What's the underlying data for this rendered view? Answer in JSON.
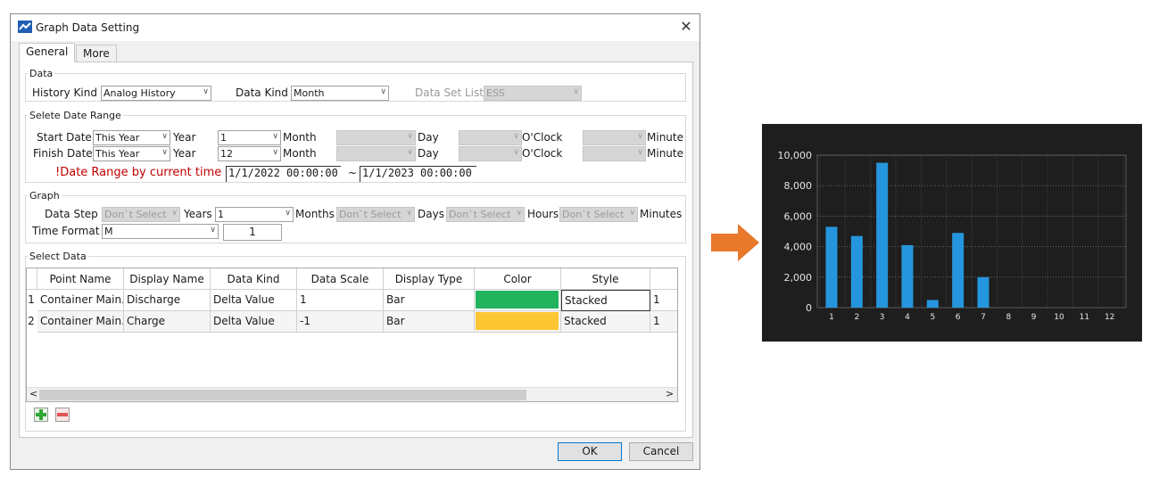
{
  "dialog": {
    "title": "Graph Data Setting",
    "close": "✕",
    "tabs": [
      "General",
      "More"
    ],
    "data_section": {
      "legend": "Data",
      "history_kind_label": "History Kind :",
      "history_kind_value": "Analog History",
      "data_kind_label": "Data Kind :",
      "data_kind_value": "Month",
      "data_set_list_label": "Data Set List :",
      "data_set_list_value": "ESS"
    },
    "date_range": {
      "legend": "Selete Date Range",
      "start_label": "Start Date :",
      "finish_label": "Finish Date :",
      "start": {
        "year_combo": "This Year",
        "month": "1"
      },
      "finish": {
        "year_combo": "This Year",
        "month": "12"
      },
      "year_label": "Year",
      "month_label": "Month",
      "day_label": "Day",
      "oclock_label": "O'Clock",
      "minute_label": "Minute",
      "note": "!Date Range by current time :",
      "from": "1/1/2022 00:00:00",
      "tilde": "~",
      "to": "1/1/2023 00:00:00"
    },
    "graph": {
      "legend": "Graph",
      "data_step_label": "Data Step :",
      "dont_select": "Don`t Select",
      "years_label": "Years",
      "years_value": "1",
      "months_label": "Months",
      "days_label": "Days",
      "hours_label": "Hours",
      "minutes_label": "Minutes",
      "time_format_label": "Time Format :",
      "time_format_value": "M",
      "time_format_num": "1"
    },
    "select_data": {
      "legend": "Select Data",
      "columns": [
        "Point Name",
        "Display Name",
        "Data Kind",
        "Data Scale",
        "Display Type",
        "Color",
        "Style"
      ],
      "rows": [
        {
          "no": "1",
          "point": "Container Main....",
          "display": "Discharge",
          "kind": "Delta Value",
          "scale": "1",
          "type": "Bar",
          "color": "#22b35c",
          "style": "Stacked",
          "extra": "1"
        },
        {
          "no": "2",
          "point": "Container Main....",
          "display": "Charge",
          "kind": "Delta Value",
          "scale": "-1",
          "type": "Bar",
          "color": "#fcc732",
          "style": "Stacked",
          "extra": "1"
        }
      ],
      "scroll_left": "<",
      "scroll_right": ">"
    },
    "buttons": {
      "ok": "OK",
      "cancel": "Cancel"
    }
  },
  "colors": {
    "arrow": "#e8782a",
    "bar": "#2596dd",
    "chart_bg": "#1e1e1e"
  },
  "chart_data": {
    "type": "bar",
    "categories": [
      "1",
      "2",
      "3",
      "4",
      "5",
      "6",
      "7",
      "8",
      "9",
      "10",
      "11",
      "12"
    ],
    "values": [
      5300,
      4700,
      9500,
      4100,
      500,
      4900,
      2000,
      0,
      0,
      0,
      0,
      0
    ],
    "ylim": [
      0,
      10000
    ],
    "yticks": [
      "0",
      "2,000",
      "4,000",
      "6,000",
      "8,000",
      "10,000"
    ],
    "grid": true
  }
}
